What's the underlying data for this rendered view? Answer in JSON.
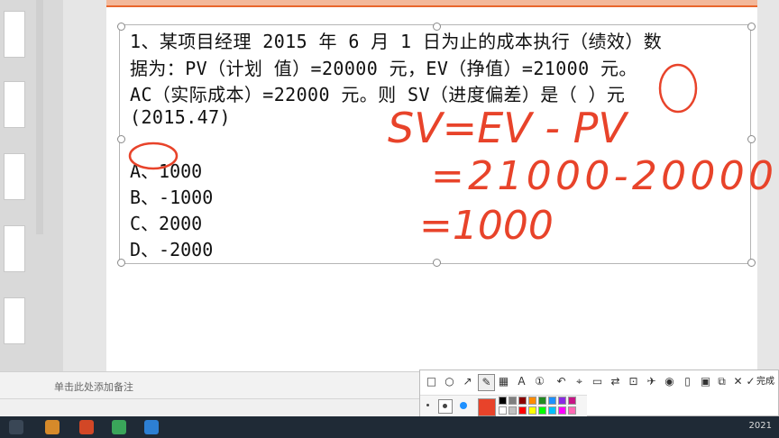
{
  "question": {
    "line1": "1、某项目经理 2015 年 6 月 1 日为止的成本执行（绩效）数",
    "line2": "据为：PV（计划 值）=20000 元，EV（挣值）=21000 元。",
    "line3": "AC（实际成本）=22000 元。则 SV（进度偏差）是（ ）元",
    "line4": "(2015.47)"
  },
  "options": [
    "A、1000",
    "B、-1000",
    "C、2000",
    "D、-2000"
  ],
  "annotation": {
    "formula": "SV=EV - PV",
    "step1": "=21000-20000",
    "step2": "=1000"
  },
  "notes": {
    "placeholder": "单击此处添加备注"
  },
  "toolbar": {
    "done_label": "完成"
  },
  "taskbar": {
    "clock": "2021"
  },
  "colors": {
    "ink": "#e8432a",
    "accent_bar": "#e9662c",
    "palette": [
      "#000000",
      "#7f7f7f",
      "#8b0000",
      "#ff8c00",
      "#228b22",
      "#1e90ff",
      "#8a2be2",
      "#c71585",
      "#ffffff",
      "#c0c0c0",
      "#ff0000",
      "#ffff00",
      "#00ff00",
      "#00bfff",
      "#ff00ff",
      "#ff69b4"
    ]
  }
}
